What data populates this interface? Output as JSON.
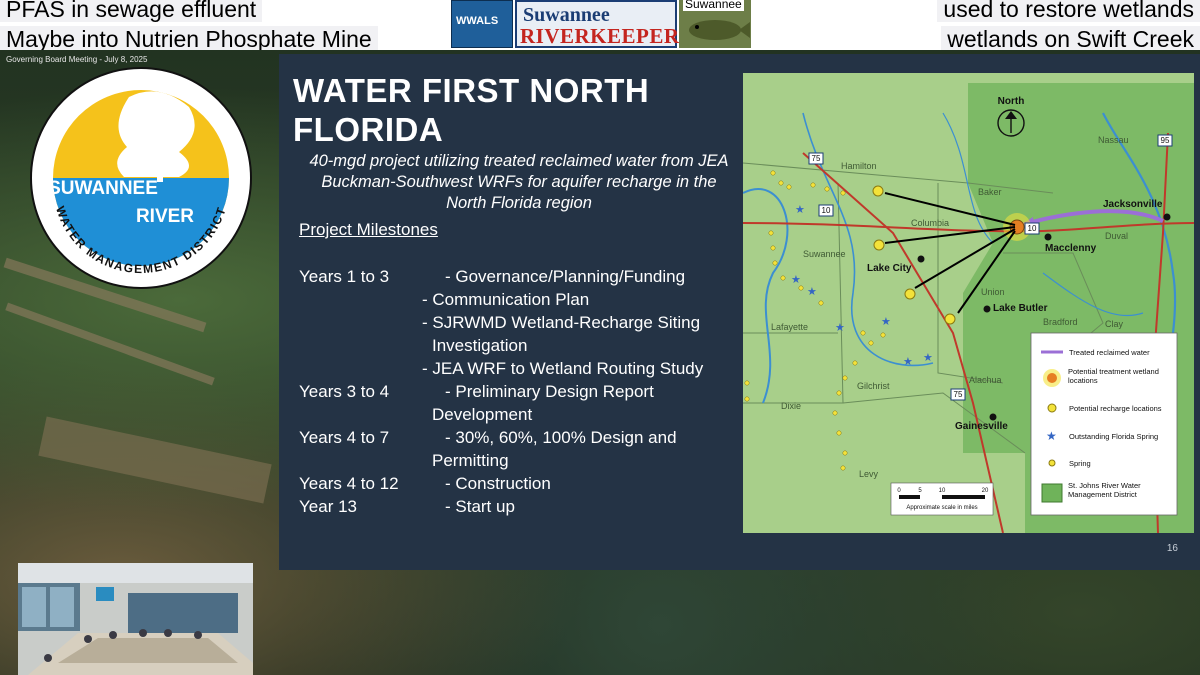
{
  "captions": {
    "top_left": "PFAS in sewage effluent",
    "bottom_left": "Maybe into Nutrien Phosphate Mine",
    "top_right": "used to restore wetlands",
    "bottom_right": "wetlands on Swift Creek"
  },
  "riverkeeper_logo": {
    "left_badge": "WWALS",
    "word_top": "Suwannee",
    "word_bottom": "RIVERKEEPER",
    "right_word": "Suwannee"
  },
  "video": {
    "meeting_title": "Governing Board Meeting - July 8, 2025"
  },
  "seal": {
    "line1": "SUWANNEE",
    "line2": "RIVER",
    "ring": "WATER MANAGEMENT DISTRICT"
  },
  "slide": {
    "title": "WATER FIRST NORTH FLORIDA",
    "subtitle": "40-mgd project utilizing treated reclaimed water from JEA Buckman-Southwest WRFs for aquifer recharge in the North Florida region",
    "milestones_heading": "Project Milestones",
    "milestones": [
      {
        "years": "Years 1 to 3",
        "items": [
          "- Governance/Planning/Funding",
          "- Communication Plan",
          "- SJRWMD Wetland-Recharge Siting",
          "Investigation",
          "- JEA WRF to Wetland Routing Study"
        ]
      },
      {
        "years": "Years 3 to 4",
        "items": [
          "- Preliminary Design Report",
          "Development"
        ]
      },
      {
        "years": "Years 4 to 7",
        "items": [
          "- 30%, 60%, 100% Design and",
          "Permitting"
        ]
      },
      {
        "years": "Years 4 to 12",
        "items": [
          "- Construction"
        ]
      },
      {
        "years": "Year 13",
        "items": [
          "- Start up"
        ]
      }
    ],
    "page_number": "16"
  },
  "map": {
    "north_label": "North",
    "counties": [
      "Hamilton",
      "Baker",
      "Nassau",
      "Columbia",
      "Suwannee",
      "Duval",
      "Union",
      "Bradford",
      "Clay",
      "Lafayette",
      "Gilchrist",
      "Alachua",
      "Dixie",
      "Levy"
    ],
    "cities": [
      "Jacksonville",
      "Macclenny",
      "Lake City",
      "Lake Butler",
      "Gainesville"
    ],
    "highways": [
      "75",
      "10",
      "95",
      "10",
      "75"
    ],
    "scale_ticks": [
      "0",
      "5",
      "10",
      "20"
    ],
    "scale_caption": "Approximate scale in miles",
    "legend": [
      {
        "label": "Treated reclaimed water"
      },
      {
        "label": "Potential treatment wetland locations"
      },
      {
        "label": "Potential recharge locations"
      },
      {
        "label": "Outstanding Florida Spring"
      },
      {
        "label": "Spring"
      },
      {
        "label": "St. Johns River Water Management District"
      }
    ],
    "colors": {
      "land": "#a8cf8a",
      "sjrwmd": "#6fb35a",
      "river": "#3c8fd1",
      "road": "#c0392b",
      "pipeline": "#9b6fd6",
      "spring": "#f3e23a"
    }
  },
  "colors": {
    "slide_bg": "#243345",
    "seal_yellow": "#f5c21b",
    "seal_blue": "#1f8fd6"
  }
}
